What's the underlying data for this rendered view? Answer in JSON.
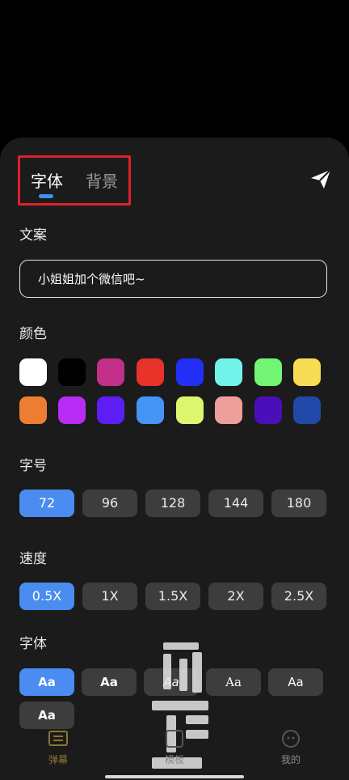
{
  "tabs": {
    "font_label": "字体",
    "background_label": "背景"
  },
  "sections": {
    "text_title": "文案",
    "color_title": "颜色",
    "size_title": "字号",
    "speed_title": "速度",
    "font_title": "字体"
  },
  "text_input": {
    "value": "小姐姐加个微信吧~"
  },
  "colors": [
    "#ffffff",
    "#000000",
    "#c22f88",
    "#e8332a",
    "#2230f5",
    "#71f3ea",
    "#72f572",
    "#f8dc53",
    "#ed7d32",
    "#b82cf5",
    "#5c1ef5",
    "#4495f5",
    "#dcf76e",
    "#ee9f9c",
    "#4a0fb8",
    "#2148a8"
  ],
  "sizes": {
    "options": [
      "72",
      "96",
      "128",
      "144",
      "180"
    ],
    "selected": "72"
  },
  "speeds": {
    "options": [
      "0.5X",
      "1X",
      "1.5X",
      "2X",
      "2.5X"
    ],
    "selected": "0.5X"
  },
  "fonts": {
    "options": [
      "Aa",
      "Aa",
      "Aa",
      "Aa",
      "Aa",
      "Aa"
    ],
    "selected_index": 0
  },
  "bottom_nav": {
    "danmu_label": "弹幕",
    "template_label": "模板",
    "mine_label": "我的",
    "active_color": "#8b7632"
  },
  "accent_color": "#4a8cf0",
  "icons": {
    "send": "send-icon",
    "danmu": "danmu-icon",
    "template": "template-icon",
    "mine": "mine-icon"
  }
}
